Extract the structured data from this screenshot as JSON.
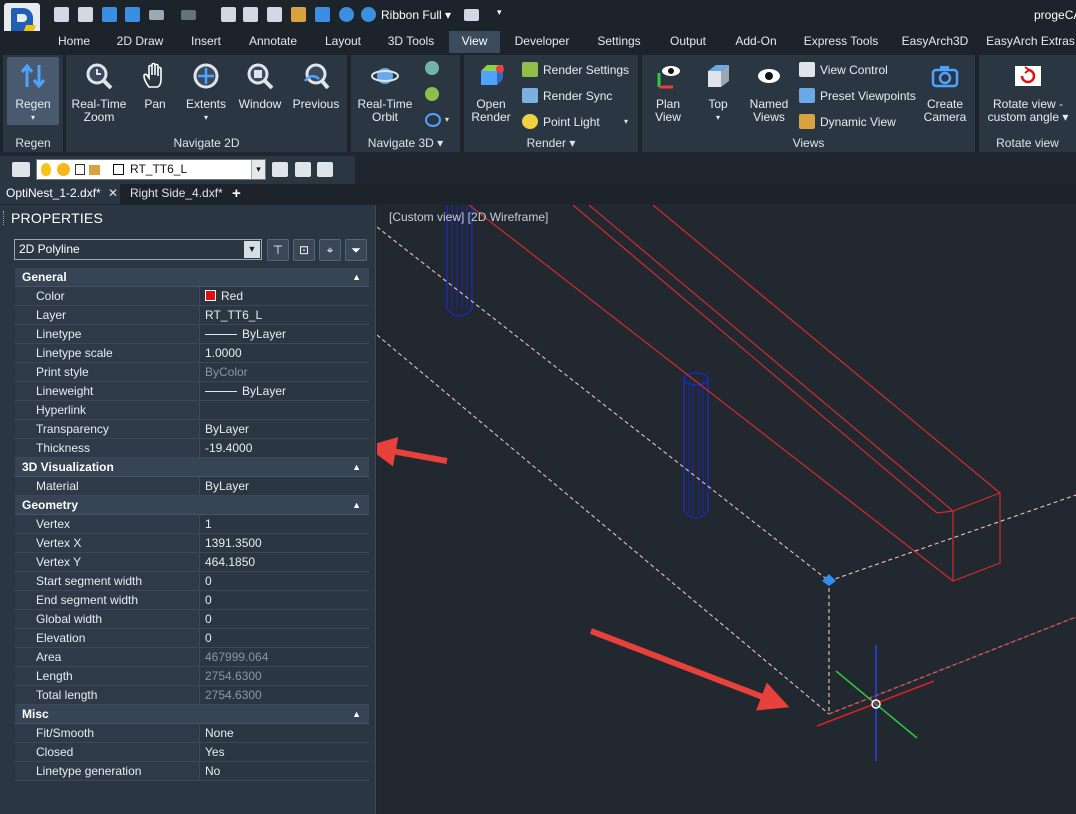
{
  "titlebar": {
    "ribbon_mode": "Ribbon Full",
    "app_title": "progeCA",
    "quick_access_icons": [
      "new-icon",
      "open-icon",
      "save-icon",
      "save-all-icon",
      "undo-icon",
      "redo-icon",
      "publish-icon",
      "print-icon",
      "print-preview-icon",
      "clean-icon",
      "sort-icon",
      "help-icon",
      "settings-icon"
    ]
  },
  "tabs": [
    "Home",
    "2D Draw",
    "Insert",
    "Annotate",
    "Layout",
    "3D Tools",
    "View",
    "Developer",
    "Settings",
    "Output",
    "Add-On",
    "Express Tools",
    "EasyArch3D",
    "EasyArch Extras"
  ],
  "active_tab": "View",
  "ribbon": {
    "regen": {
      "button": "Regen",
      "title": "Regen"
    },
    "navigate2d": {
      "title": "Navigate 2D",
      "buttons": [
        [
          "Real-Time",
          "Zoom"
        ],
        [
          "Pan",
          ""
        ],
        [
          "Extents",
          ""
        ],
        [
          "Window",
          ""
        ],
        [
          "Previous",
          ""
        ]
      ]
    },
    "navigate3d": {
      "title": "Navigate 3D",
      "orbit": [
        "Real-Time",
        "Orbit"
      ]
    },
    "render": {
      "title": "Render",
      "open_render": [
        "Open",
        "Render"
      ],
      "items": [
        "Render Settings",
        "Render Sync",
        "Point Light"
      ]
    },
    "views": {
      "title": "Views",
      "plan_view": [
        "Plan",
        "View"
      ],
      "top": "Top",
      "named_views": [
        "Named",
        "Views"
      ],
      "items": [
        "View Control",
        "Preset Viewpoints",
        "Dynamic View"
      ],
      "create_camera": [
        "Create",
        "Camera"
      ]
    },
    "rotate_view": {
      "title": "Rotate view",
      "button": [
        "Rotate view -",
        "custom angle"
      ]
    }
  },
  "layer": {
    "current": "RT_TT6_L"
  },
  "doc_tabs": [
    "OptiNest_1-2.dxf*",
    "Right Side_4.dxf*"
  ],
  "properties": {
    "title": "PROPERTIES",
    "object_type": "2D Polyline",
    "sections": [
      {
        "name": "General",
        "rows": [
          {
            "k": "Color",
            "v": "Red",
            "swatch": "#e01010"
          },
          {
            "k": "Layer",
            "v": "RT_TT6_L"
          },
          {
            "k": "Linetype",
            "v": "ByLayer",
            "line": true
          },
          {
            "k": "Linetype scale",
            "v": "1.0000"
          },
          {
            "k": "Print style",
            "v": "ByColor",
            "ro": true
          },
          {
            "k": "Lineweight",
            "v": "ByLayer",
            "line": true
          },
          {
            "k": "Hyperlink",
            "v": ""
          },
          {
            "k": "Transparency",
            "v": "ByLayer"
          },
          {
            "k": "Thickness",
            "v": "-19.4000"
          }
        ]
      },
      {
        "name": "3D Visualization",
        "rows": [
          {
            "k": "Material",
            "v": "ByLayer"
          }
        ]
      },
      {
        "name": "Geometry",
        "rows": [
          {
            "k": "Vertex",
            "v": "1"
          },
          {
            "k": "Vertex X",
            "v": "1391.3500"
          },
          {
            "k": "Vertex Y",
            "v": "464.1850"
          },
          {
            "k": "Start segment width",
            "v": "0"
          },
          {
            "k": "End segment width",
            "v": "0"
          },
          {
            "k": "Global width",
            "v": "0"
          },
          {
            "k": "Elevation",
            "v": "0"
          },
          {
            "k": "Area",
            "v": "467999.064",
            "ro": true
          },
          {
            "k": "Length",
            "v": "2754.6300",
            "ro": true
          },
          {
            "k": "Total length",
            "v": "2754.6300",
            "ro": true
          }
        ]
      },
      {
        "name": "Misc",
        "rows": [
          {
            "k": "Fit/Smooth",
            "v": "None"
          },
          {
            "k": "Closed",
            "v": "Yes"
          },
          {
            "k": "Linetype generation",
            "v": "No"
          }
        ]
      }
    ]
  },
  "viewport": {
    "label": "[Custom view] [2D Wireframe]"
  },
  "colors": {
    "entity": "#d42a2a",
    "arrow": "#e8413b",
    "cylinder": "#1c28c8",
    "grip": "#2e8ef0"
  }
}
